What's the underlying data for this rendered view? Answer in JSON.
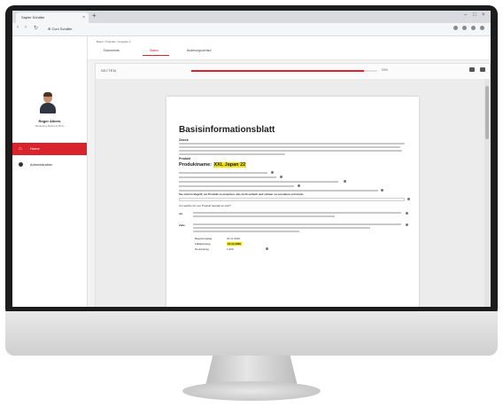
{
  "browser": {
    "tab_title": "Sapier Schäfer",
    "tab_close": "×",
    "new_tab": "+",
    "url": "⊕ Ccm Schäfer",
    "nav_back": "‹",
    "nav_forward": "›",
    "nav_reload": "↻"
  },
  "sidebar": {
    "user_name": "Roger Albers",
    "user_subtitle": "Marketing-Referent Büro",
    "items": [
      {
        "label": "Home",
        "active": true,
        "icon": "home-icon"
      },
      {
        "label": "Administration",
        "active": false,
        "icon": "settings-icon"
      }
    ]
  },
  "topbar": {
    "breadcrumb": "Basis / Produkte / Ausgabe 2",
    "tabs": [
      {
        "label": "Dokumente",
        "active": false
      },
      {
        "label": "Status",
        "active": true
      },
      {
        "label": "Änderungsverlauf",
        "active": false
      }
    ]
  },
  "panel": {
    "title": "SEITEN",
    "progress_percent": 93,
    "progress_label": "93%"
  },
  "document": {
    "title": "Basisinformationsblatt",
    "heading_intro": "Zweck",
    "heading_product": "Produkt",
    "product_label": "Produktname:",
    "product_value": "XXL Japan 22",
    "bold_notice": "Sie sind im Begriff, ein Produkt zu erwerben, das nicht einfach und schwer zu verstehen sein kann.",
    "section_label": "Um welche Art von Produkt handelt es sich?",
    "row_labels": [
      "Art",
      "Ziele"
    ],
    "kv": [
      {
        "key": "Begebungstag",
        "value": "01.11.2019",
        "highlight": false
      },
      {
        "key": "Fälligkeitstag",
        "value": "01.11.2026",
        "highlight": true
      },
      {
        "key": "Nennbetrag",
        "value": "1.000",
        "highlight": false
      }
    ]
  },
  "colors": {
    "accent": "#d9232d",
    "highlight": "#f3e400"
  }
}
